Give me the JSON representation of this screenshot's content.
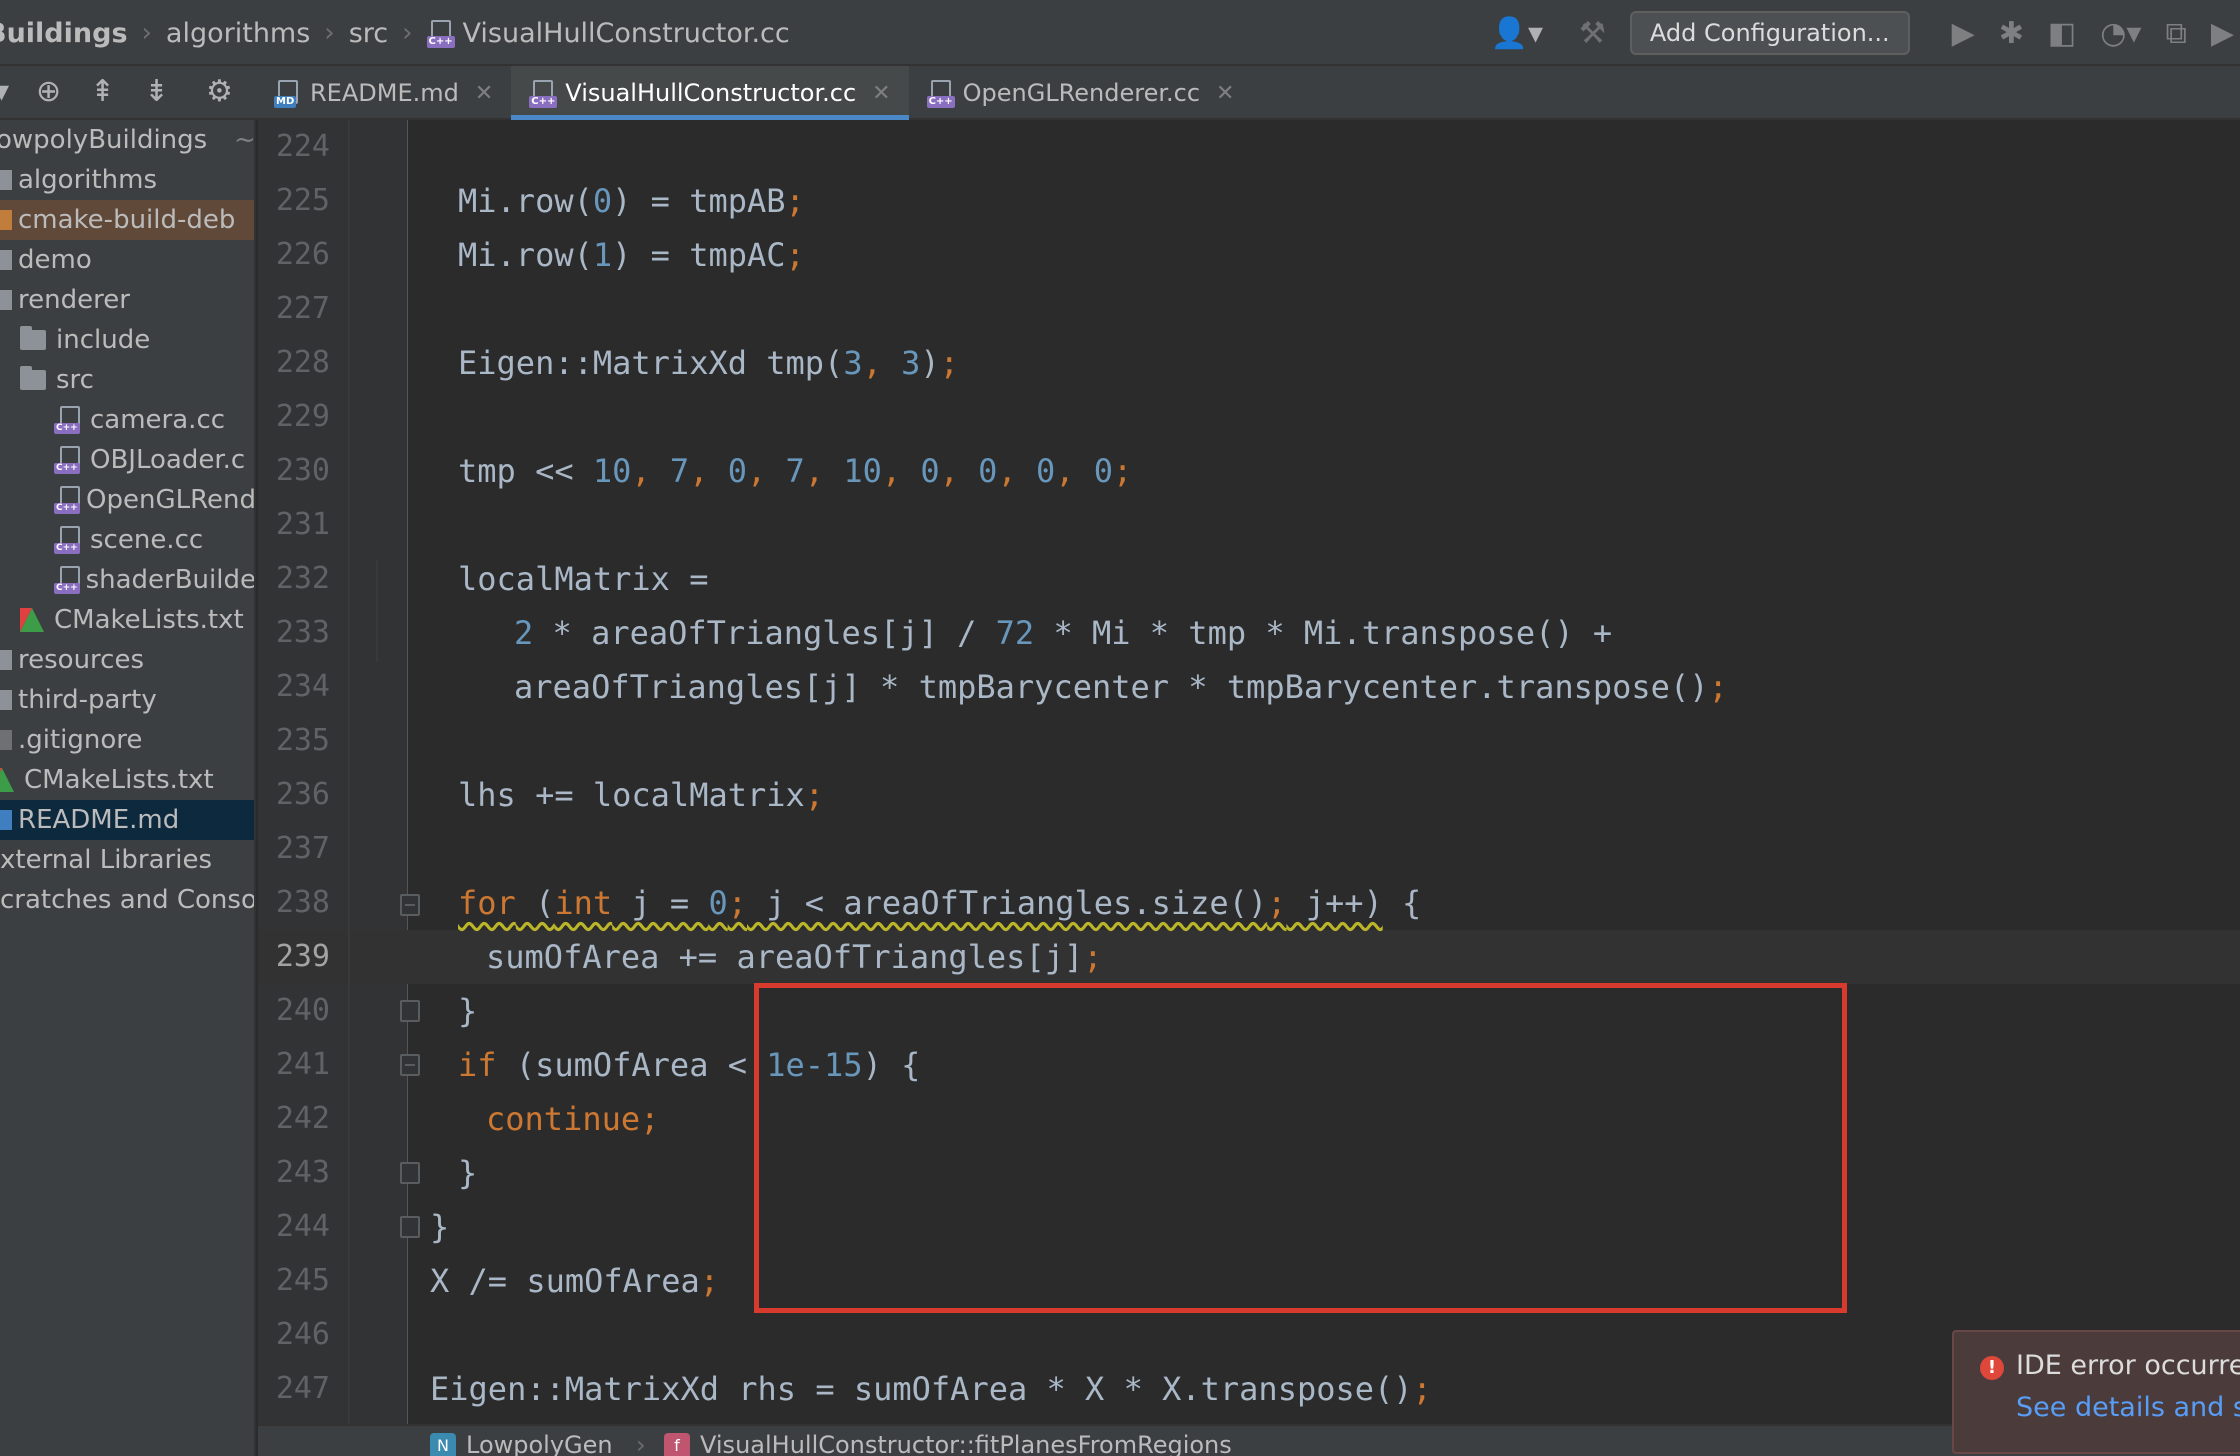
{
  "breadcrumb": {
    "items": [
      "Buildings",
      "algorithms",
      "src",
      "VisualHullConstructor.cc"
    ]
  },
  "toolbar": {
    "add_configuration": "Add Configuration..."
  },
  "tabs": [
    {
      "label": "README.md",
      "icon": "markdown-file-icon",
      "tag": "MD"
    },
    {
      "label": "VisualHullConstructor.cc",
      "icon": "cpp-file-icon",
      "tag": "C++",
      "active": true
    },
    {
      "label": "OpenGLRenderer.cc",
      "icon": "cpp-file-icon",
      "tag": "C++"
    }
  ],
  "project_tree": {
    "root": "owpolyBuildings",
    "root_suffix": "~",
    "items": [
      {
        "label": "algorithms",
        "type": "folder"
      },
      {
        "label": "cmake-build-deb",
        "type": "folder-excluded"
      },
      {
        "label": "demo",
        "type": "folder"
      },
      {
        "label": "renderer",
        "type": "folder"
      },
      {
        "label": "include",
        "type": "folder"
      },
      {
        "label": "src",
        "type": "folder"
      },
      {
        "label": "camera.cc",
        "type": "cpp"
      },
      {
        "label": "OBJLoader.c",
        "type": "cpp"
      },
      {
        "label": "OpenGLRend",
        "type": "cpp"
      },
      {
        "label": "scene.cc",
        "type": "cpp"
      },
      {
        "label": "shaderBuilde",
        "type": "cpp"
      },
      {
        "label": "CMakeLists.txt",
        "type": "cmake"
      },
      {
        "label": "resources",
        "type": "folder"
      },
      {
        "label": "third-party",
        "type": "folder"
      },
      {
        "label": ".gitignore",
        "type": "file"
      },
      {
        "label": "CMakeLists.txt",
        "type": "cmake"
      },
      {
        "label": "README.md",
        "type": "md"
      },
      {
        "label": "xternal Libraries",
        "type": "lib"
      },
      {
        "label": "cratches and Conso",
        "type": "scratch"
      }
    ]
  },
  "editor": {
    "current_line": 239,
    "lines": [
      {
        "n": 224,
        "code": ""
      },
      {
        "n": 225,
        "code": "Mi.row(0) = tmpAB;"
      },
      {
        "n": 226,
        "code": "Mi.row(1) = tmpAC;"
      },
      {
        "n": 227,
        "code": ""
      },
      {
        "n": 228,
        "code": "Eigen::MatrixXd tmp(3, 3);"
      },
      {
        "n": 229,
        "code": ""
      },
      {
        "n": 230,
        "code": "tmp << 10, 7, 0, 7, 10, 0, 0, 0, 0;"
      },
      {
        "n": 231,
        "code": ""
      },
      {
        "n": 232,
        "code": "localMatrix ="
      },
      {
        "n": 233,
        "code": "2 * areaOfTriangles[j] / 72 * Mi * tmp * Mi.transpose() +"
      },
      {
        "n": 234,
        "code": "areaOfTriangles[j] * tmpBarycenter * tmpBarycenter.transpose();"
      },
      {
        "n": 235,
        "code": ""
      },
      {
        "n": 236,
        "code": "lhs += localMatrix;"
      },
      {
        "n": 237,
        "code": ""
      },
      {
        "n": 238,
        "code": "for (int j = 0; j < areaOfTriangles.size(); j++) {"
      },
      {
        "n": 239,
        "code": "sumOfArea += areaOfTriangles[j];"
      },
      {
        "n": 240,
        "code": "}"
      },
      {
        "n": 241,
        "code": "if (sumOfArea < 1e-15) {"
      },
      {
        "n": 242,
        "code": "continue;"
      },
      {
        "n": 243,
        "code": "}"
      },
      {
        "n": 244,
        "code": "}"
      },
      {
        "n": 245,
        "code": "X /= sumOfArea;"
      },
      {
        "n": 246,
        "code": ""
      },
      {
        "n": 247,
        "code": "Eigen::MatrixXd rhs = sumOfArea * X * X.transpose();"
      }
    ]
  },
  "status_breadcrumb": {
    "module": "LowpolyGen",
    "module_badge": "N",
    "function": "VisualHullConstructor::fitPlanesFromRegions",
    "function_badge": "f"
  },
  "notification": {
    "title": "IDE error occurre",
    "link": "See details and s"
  },
  "colors": {
    "keyword": "#cc7832",
    "number": "#6897bb",
    "text": "#a9b7c6",
    "highlight_box": "#d93a2e",
    "active_tab_underline": "#4a88c7"
  }
}
